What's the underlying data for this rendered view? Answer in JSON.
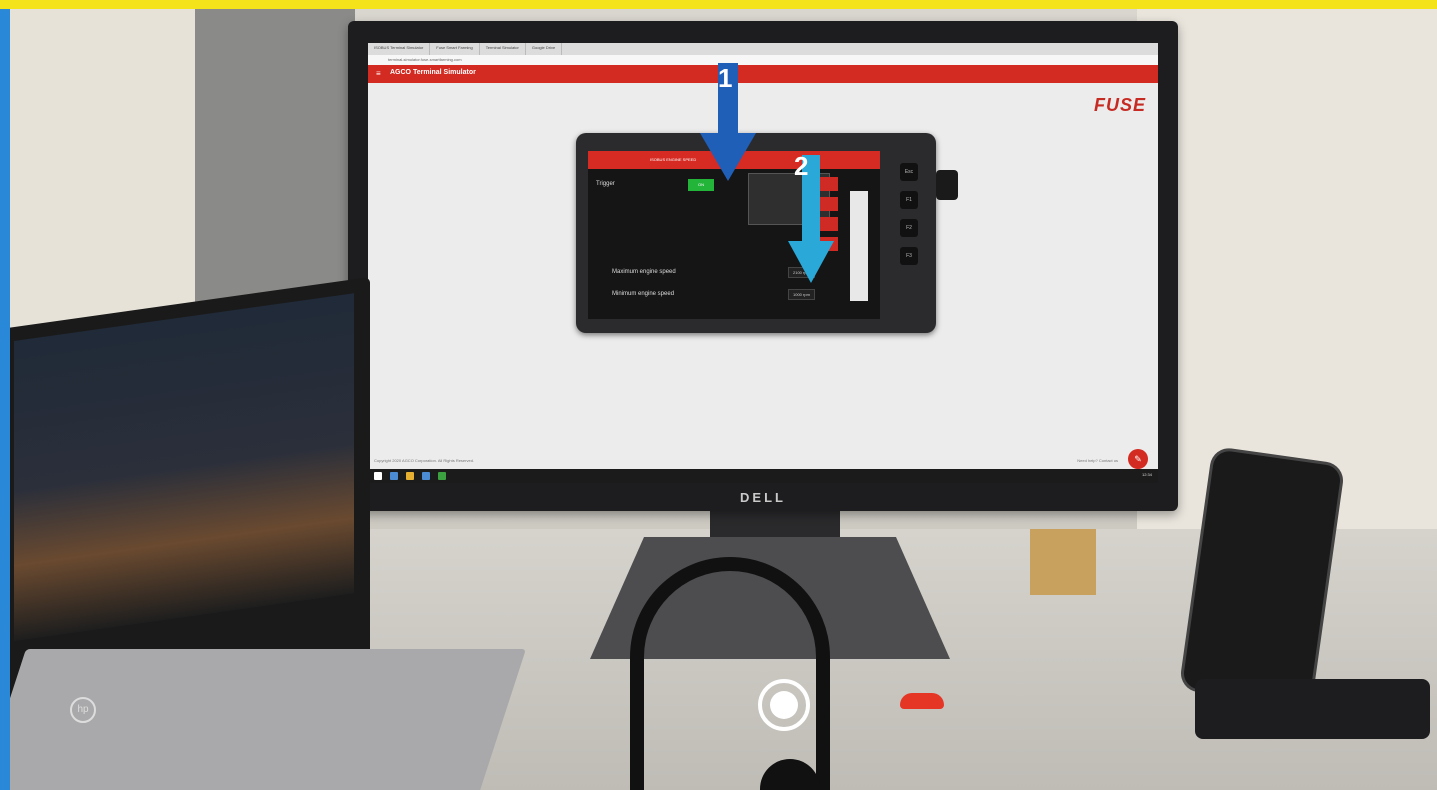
{
  "browser": {
    "tabs": [
      "ISOBUS Terminal Simulator",
      "Fuse Smart Farming",
      "Terminal Simulator",
      "Google Drive"
    ],
    "address": "terminal-simulator.fuse-smartfarming.com"
  },
  "app": {
    "title": "AGCO Terminal Simulator",
    "brand": "FUSE",
    "copyright": "Copyright 2020 AGCO Corporation. All Rights Reserved.",
    "help": "Need help? Contact us",
    "fab_icon": "wrench-icon"
  },
  "terminal": {
    "header_label": "ISOBUS ENGINE SPEED",
    "switch_label": "ON",
    "trigger_label": "Trigger",
    "rows": [
      {
        "label": "Maximum engine speed",
        "value": "2100 rpm"
      },
      {
        "label": "Minimum engine speed",
        "value": "1000 rpm"
      }
    ],
    "side_buttons": [
      "Esc",
      "F1",
      "F2",
      "F3"
    ]
  },
  "annotations": {
    "arrow1_label": "1",
    "arrow2_label": "2",
    "arrow1_color": "#1f5fb8",
    "arrow2_color": "#2aa8d8"
  },
  "monitor": {
    "brand": "DELL"
  },
  "laptop": {
    "brand": "hp"
  },
  "taskbar": {
    "clock": "12:34"
  },
  "overlay": {
    "shutter_icon": "camera-shutter-icon",
    "hangup_icon": "phone-hangup-icon",
    "hangup_color": "#e53525"
  }
}
